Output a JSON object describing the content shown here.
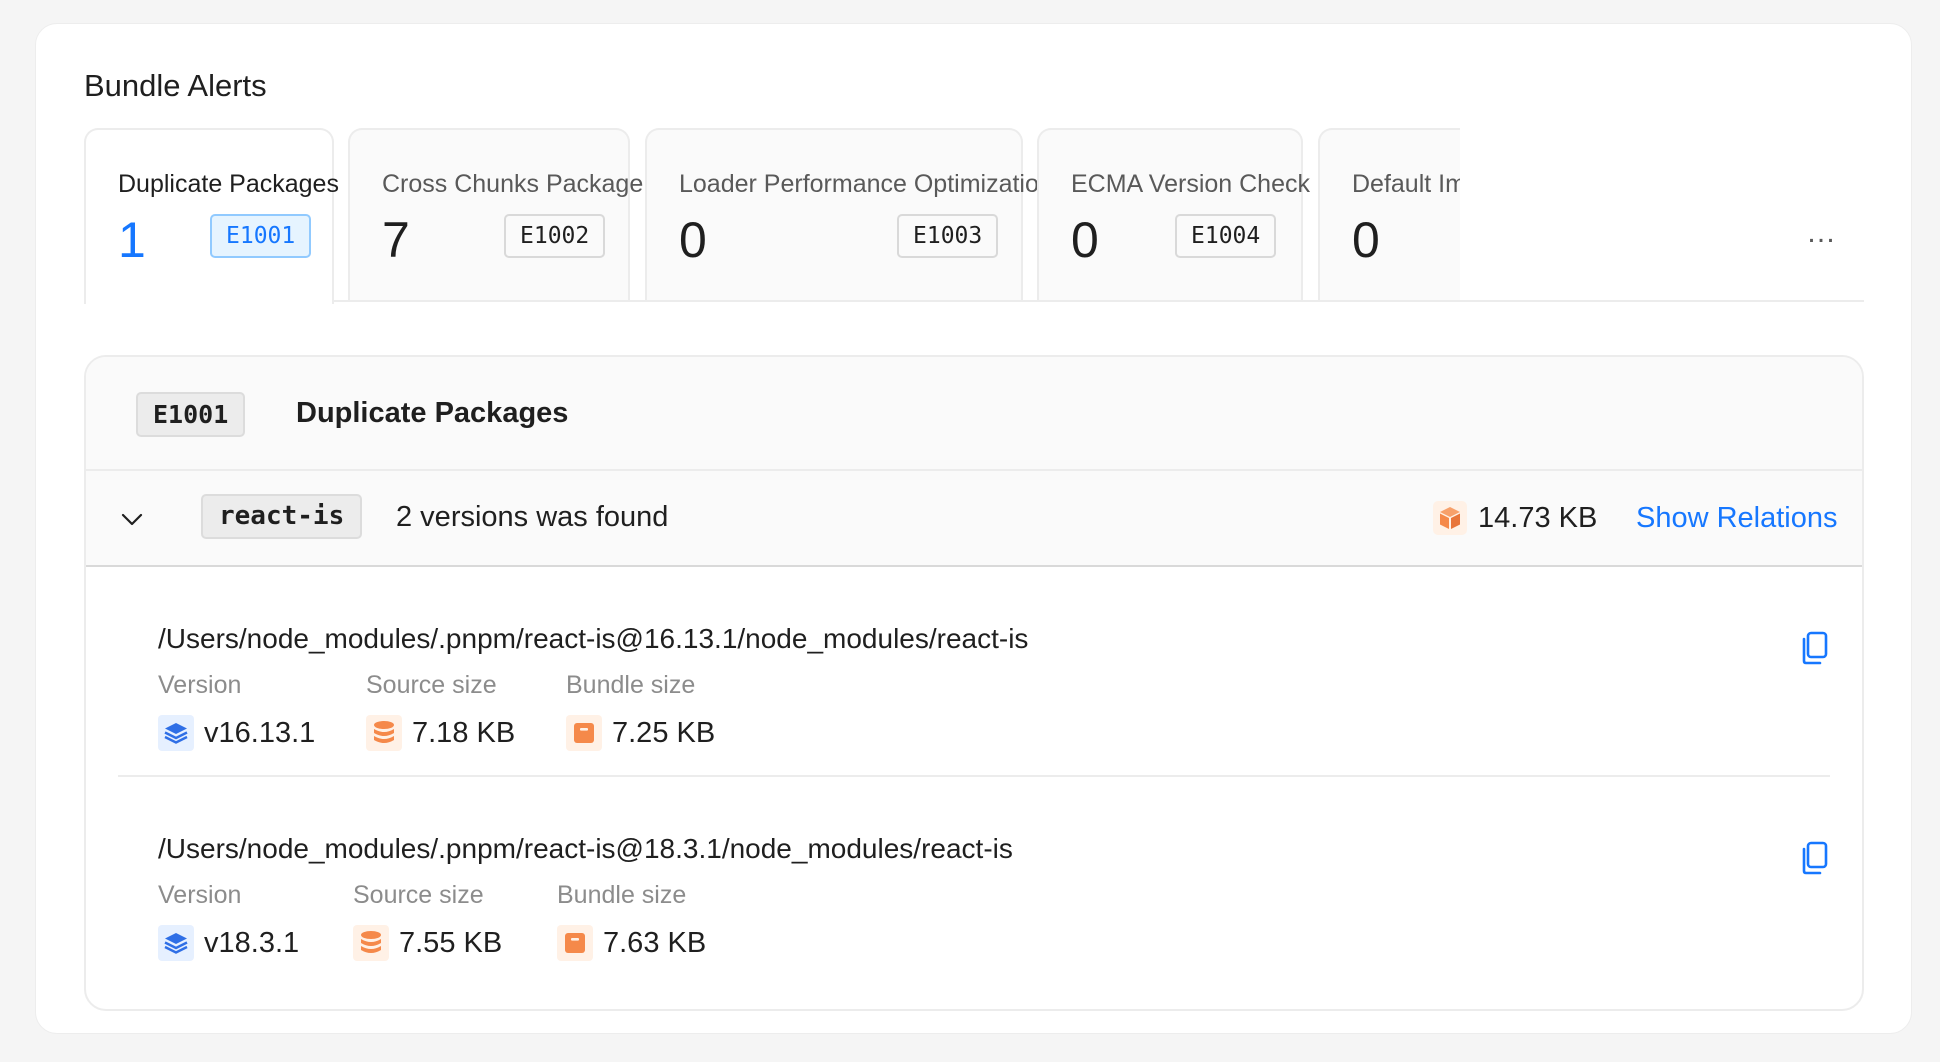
{
  "title": "Bundle Alerts",
  "tabs": [
    {
      "label": "Duplicate Packages",
      "count": "1",
      "code": "E1001",
      "active": true
    },
    {
      "label": "Cross Chunks Package",
      "count": "7",
      "code": "E1002"
    },
    {
      "label": "Loader Performance Optimization",
      "count": "0",
      "code": "E1003"
    },
    {
      "label": "ECMA Version Check",
      "count": "0",
      "code": "E1004"
    },
    {
      "label": "Default Im",
      "count": "0"
    }
  ],
  "tabs_more": "…",
  "panel": {
    "code": "E1001",
    "title": "Duplicate Packages",
    "package": {
      "name": "react-is",
      "found_text": "2 versions was found",
      "size": "14.73 KB",
      "show_relations": "Show Relations"
    },
    "entries": [
      {
        "path": "/Users/node_modules/.pnpm/react-is@16.13.1/node_modules/react-is",
        "version_label": "Version",
        "version": "v16.13.1",
        "source_label": "Source size",
        "source": "7.18 KB",
        "bundle_label": "Bundle size",
        "bundle": "7.25 KB"
      },
      {
        "path": "/Users/node_modules/.pnpm/react-is@18.3.1/node_modules/react-is",
        "version_label": "Version",
        "version": "v18.3.1",
        "source_label": "Source size",
        "source": "7.55 KB",
        "bundle_label": "Bundle size",
        "bundle": "7.63 KB"
      }
    ]
  },
  "colors": {
    "accent": "#1677ff",
    "orange": "#f5894a",
    "blue_icon": "#2f6fe6"
  },
  "icons": {
    "chevron": "chevron-down-icon",
    "package_size": "package-box-icon",
    "copy": "copy-icon",
    "version": "layers-icon",
    "source": "database-icon",
    "bundle": "archive-icon"
  }
}
